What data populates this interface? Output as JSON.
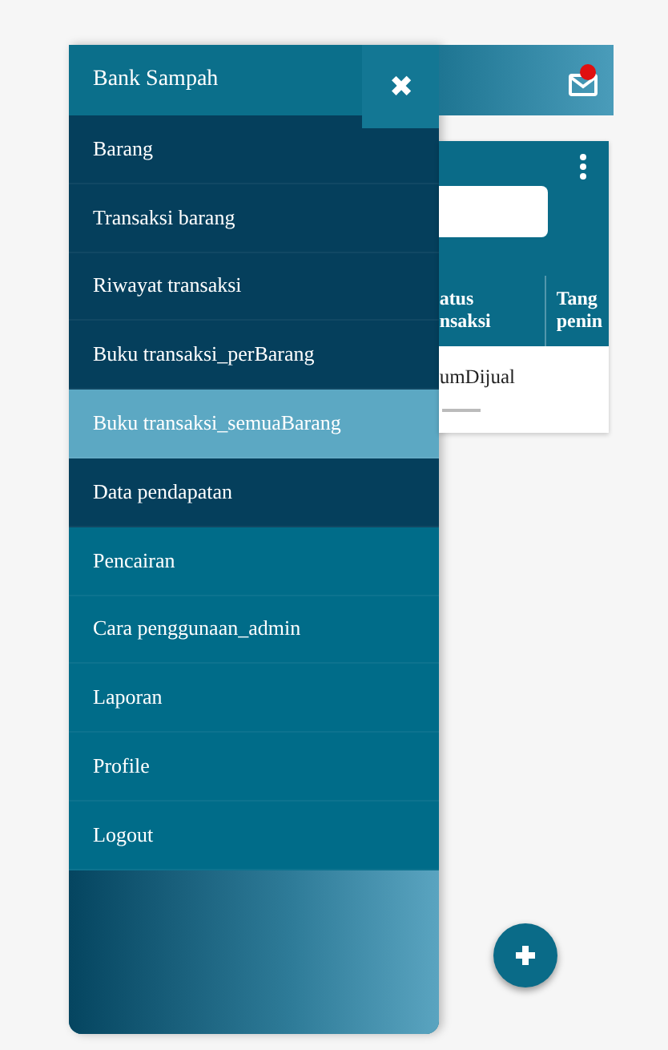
{
  "drawer": {
    "title": "Bank Sampah",
    "close_icon": "✖",
    "items": [
      {
        "label": "Barang",
        "kind": "dark",
        "selected": false
      },
      {
        "label": "Transaksi barang",
        "kind": "dark",
        "selected": false
      },
      {
        "label": "Riwayat transaksi",
        "kind": "dark",
        "selected": false
      },
      {
        "label": "Buku transaksi_perBarang",
        "kind": "dark",
        "selected": false
      },
      {
        "label": "Buku transaksi_semuaBarang",
        "selected": true
      },
      {
        "label": "Data pendapatan",
        "kind": "dark",
        "selected": false
      },
      {
        "label": "Pencairan",
        "kind": "normal",
        "selected": false
      },
      {
        "label": "Cara penggunaan_admin",
        "kind": "normal",
        "selected": false
      },
      {
        "label": "Laporan",
        "kind": "normal",
        "selected": false
      },
      {
        "label": "Profile",
        "kind": "normal",
        "selected": false
      },
      {
        "label": "Logout",
        "kind": "normal",
        "selected": false
      }
    ]
  },
  "table": {
    "columns": [
      "atus\nnsaksi",
      "Tang\npenin"
    ],
    "rows": [
      [
        "umDijual"
      ]
    ]
  }
}
